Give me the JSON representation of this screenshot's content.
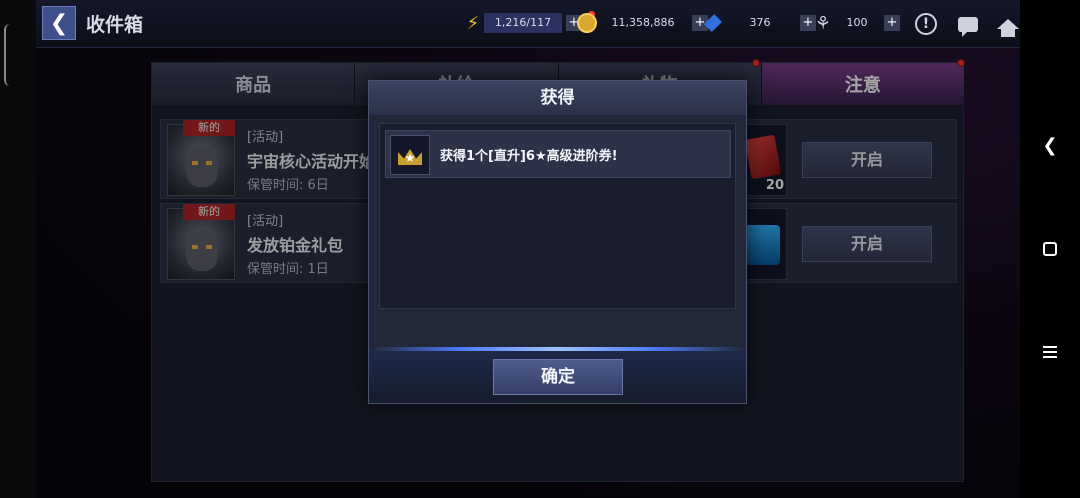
{
  "header": {
    "title": "收件箱"
  },
  "resources": {
    "energy": "1,216/117",
    "gold": "11,358,886",
    "crystal": "376",
    "fire": "100"
  },
  "tabs": [
    {
      "label": "商品"
    },
    {
      "label": "补给"
    },
    {
      "label": "礼物"
    },
    {
      "label": "注意"
    }
  ],
  "mail_items": [
    {
      "badge": "新的",
      "tag": "[活动]",
      "name": "宇宙核心活动开始",
      "time": "保管时间: 6日",
      "item_count": "20",
      "button": "开启"
    },
    {
      "badge": "新的",
      "tag": "[活动]",
      "name": "发放铂金礼包",
      "time": "保管时间: 1日",
      "item_count": "",
      "button": "开启"
    }
  ],
  "modal": {
    "title": "获得",
    "reward_text": "获得1个[直升]6★高级进阶券!",
    "confirm": "确定"
  },
  "colors": {
    "accent": "#4f7cff",
    "badge": "#b0262a",
    "notification": "#ff3030"
  }
}
